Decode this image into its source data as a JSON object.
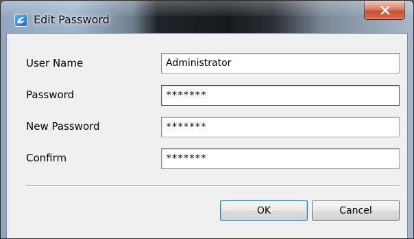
{
  "window": {
    "title": "Edit Password",
    "icon": "app-swirl-icon",
    "close_icon": "close-x-icon"
  },
  "form": {
    "fields": [
      {
        "label": "User Name",
        "value": "Administrator",
        "type": "text"
      },
      {
        "label": "Password",
        "value": "*******",
        "type": "password"
      },
      {
        "label": "New Password",
        "value": "*******",
        "type": "password"
      },
      {
        "label": "Confirm",
        "value": "*******",
        "type": "password"
      }
    ]
  },
  "buttons": {
    "ok_label": "OK",
    "cancel_label": "Cancel"
  },
  "colors": {
    "close_button": "#c2381a",
    "dialog_background": "#f0f0f0",
    "default_button_border": "#3c7fb1"
  }
}
